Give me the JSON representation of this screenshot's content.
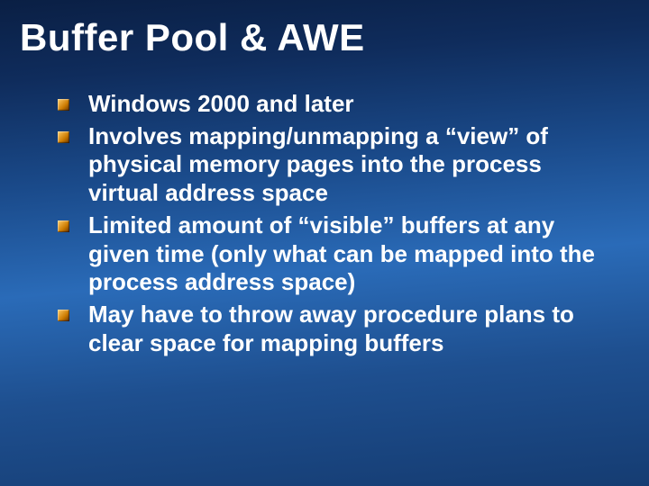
{
  "title": "Buffer Pool & AWE",
  "bullets": [
    "Windows 2000 and later",
    "Involves mapping/unmapping a “view” of physical memory pages into the process virtual address space",
    "Limited amount of “visible” buffers at any given time (only what can be mapped into the process address space)",
    "May have to throw away procedure plans to clear space for mapping buffers"
  ]
}
